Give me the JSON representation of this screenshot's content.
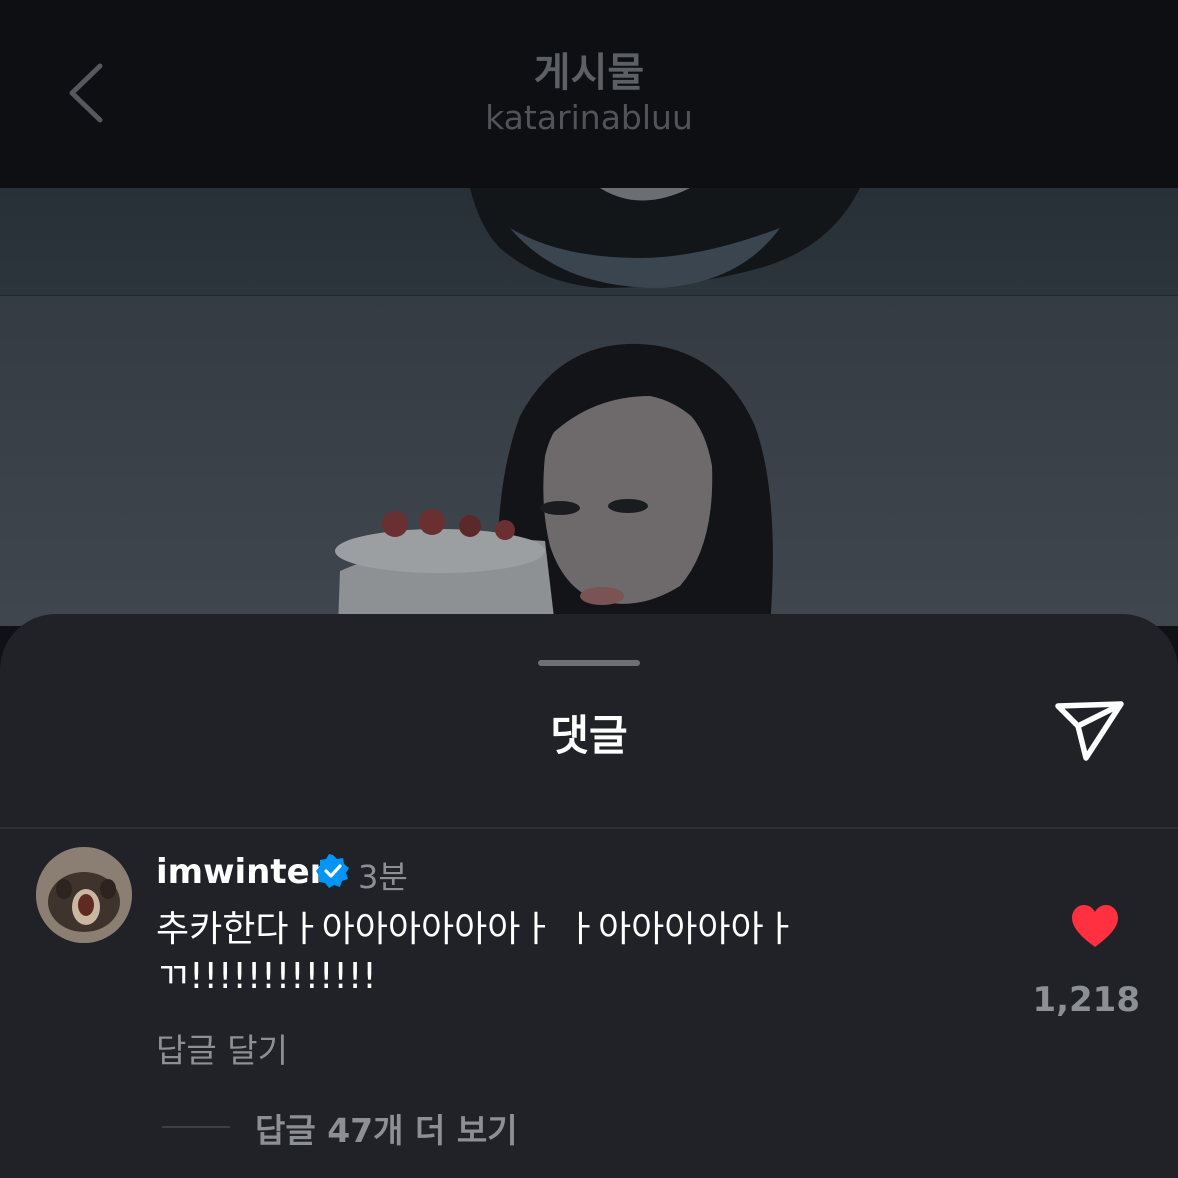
{
  "header": {
    "title": "게시물",
    "subtitle": "katarinabluu"
  },
  "photo": {
    "background": "#3a4048"
  },
  "comments_sheet": {
    "title": "댓글",
    "comment": {
      "username": "imwinter",
      "time": "3분",
      "text": "추카한다ㅏ아아아아아아ㅏ ㅏ아아아아아ㅏㄲ!!!!!!!!!!!!!",
      "likes": "1,218",
      "reply_label": "답글 달기",
      "more_replies_label": "답글 47개 더 보기"
    }
  },
  "colors": {
    "heart": "#ff3040",
    "verified": "#0095f6",
    "sheet_bg": "#202227"
  }
}
